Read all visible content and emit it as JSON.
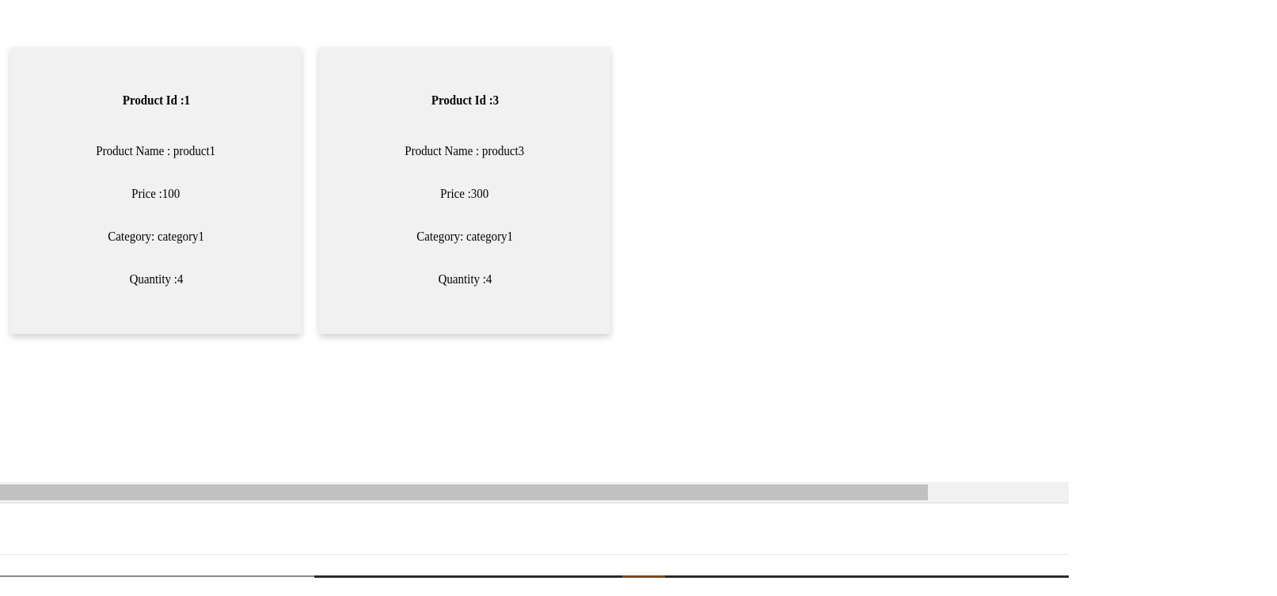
{
  "products": [
    {
      "id_label": "Product Id :1",
      "name_label": "Product Name : product1",
      "price_label": "Price :100",
      "category_label": "Category: category1",
      "quantity_label": "Quantity :4"
    },
    {
      "id_label": "Product Id :3",
      "name_label": "Product Name : product3",
      "price_label": "Price :300",
      "category_label": "Category: category1",
      "quantity_label": "Quantity :4"
    }
  ],
  "colors": {
    "card_background": "#f1f1f1",
    "scrollbar_track": "#f1f1f1",
    "scrollbar_thumb": "#c1c1c1"
  }
}
